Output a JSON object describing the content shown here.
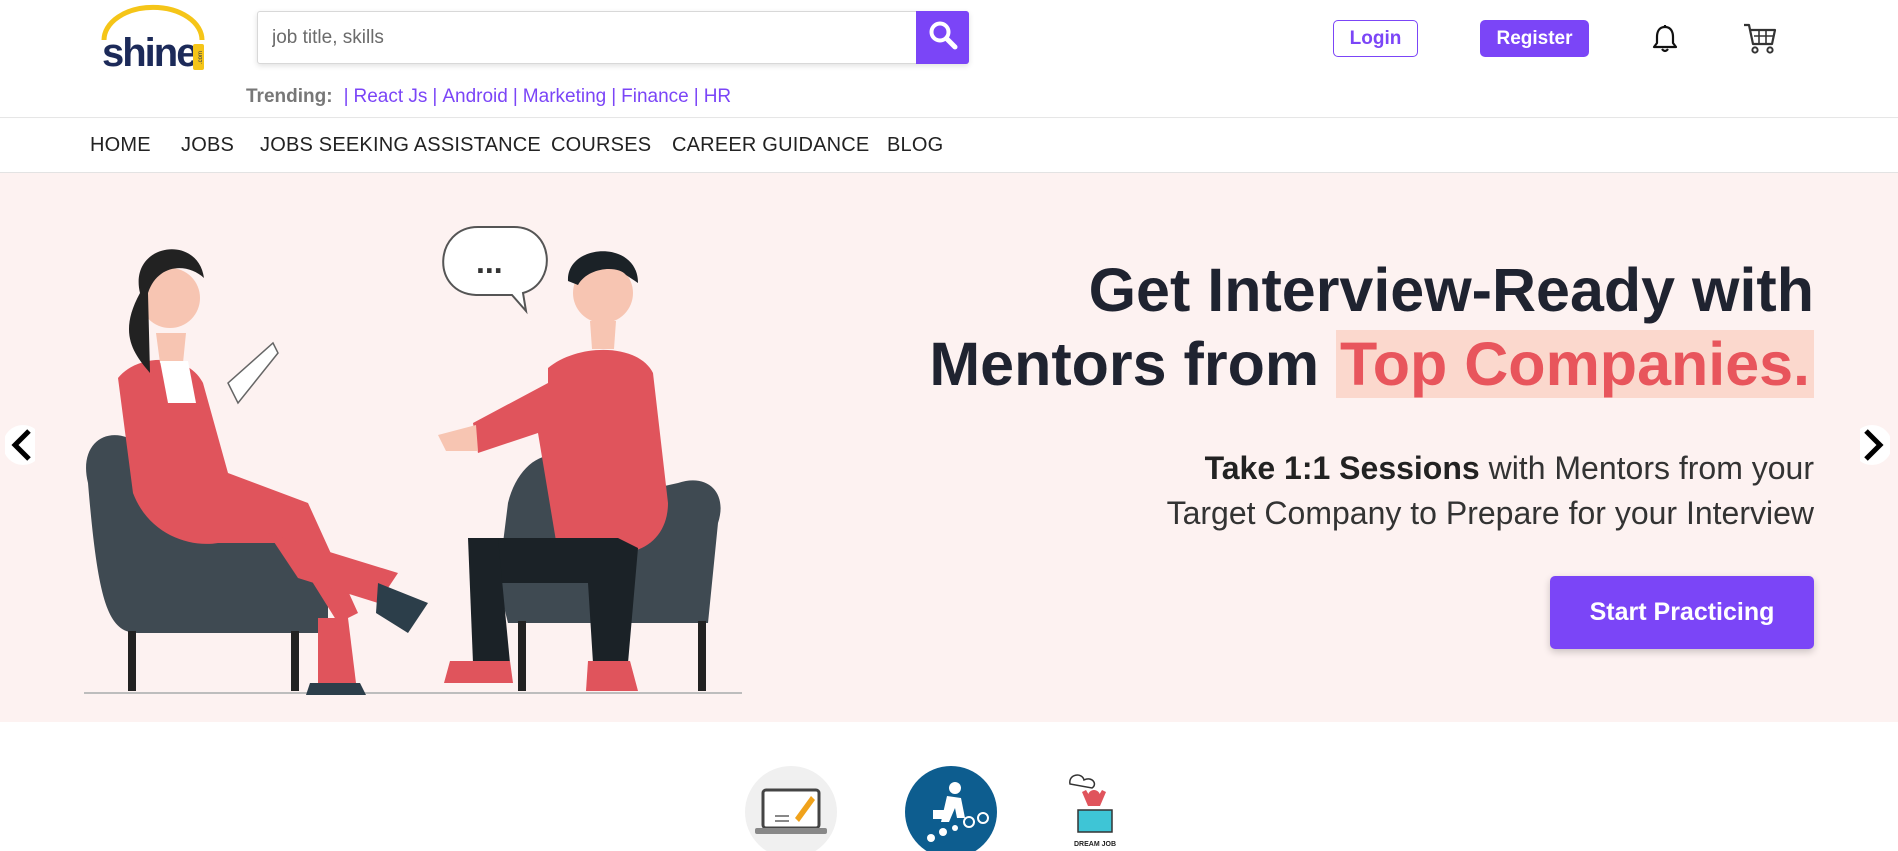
{
  "header": {
    "logo_text": "shine",
    "logo_badge": ".com",
    "search": {
      "placeholder": "job title, skills",
      "value": ""
    },
    "trending": {
      "label": "Trending:",
      "items": [
        "React Js",
        "Android",
        "Marketing",
        "Finance",
        "HR"
      ]
    },
    "login_label": "Login",
    "register_label": "Register",
    "icons": [
      "search-icon",
      "bell-icon",
      "cart-icon"
    ]
  },
  "nav": {
    "items": [
      "HOME",
      "JOBS",
      "JOBS SEEKING ASSISTANCE",
      "COURSES",
      "CAREER GUIDANCE",
      "BLOG"
    ]
  },
  "hero": {
    "title_line1": "Get Interview-Ready with",
    "title_line2_prefix": "Mentors from ",
    "title_highlight": "Top Companies.",
    "subtitle_bold": "Take 1:1 Sessions",
    "subtitle_rest_line1": " with Mentors from your",
    "subtitle_line2": "Target Company to Prepare for your Interview",
    "cta_label": "Start Practicing",
    "speech_bubble": "...",
    "prev_icon": "chevron-left-icon",
    "next_icon": "chevron-right-icon"
  },
  "categories": {
    "dream_job_label": "DREAM JOB"
  },
  "colors": {
    "brand": "#7b45f7",
    "hero_bg": "#fdf2f1",
    "highlight": "#e8555c",
    "highlight_bg": "#fbd8cd",
    "logo_yellow": "#f5c518",
    "logo_navy": "#1c2a59"
  }
}
